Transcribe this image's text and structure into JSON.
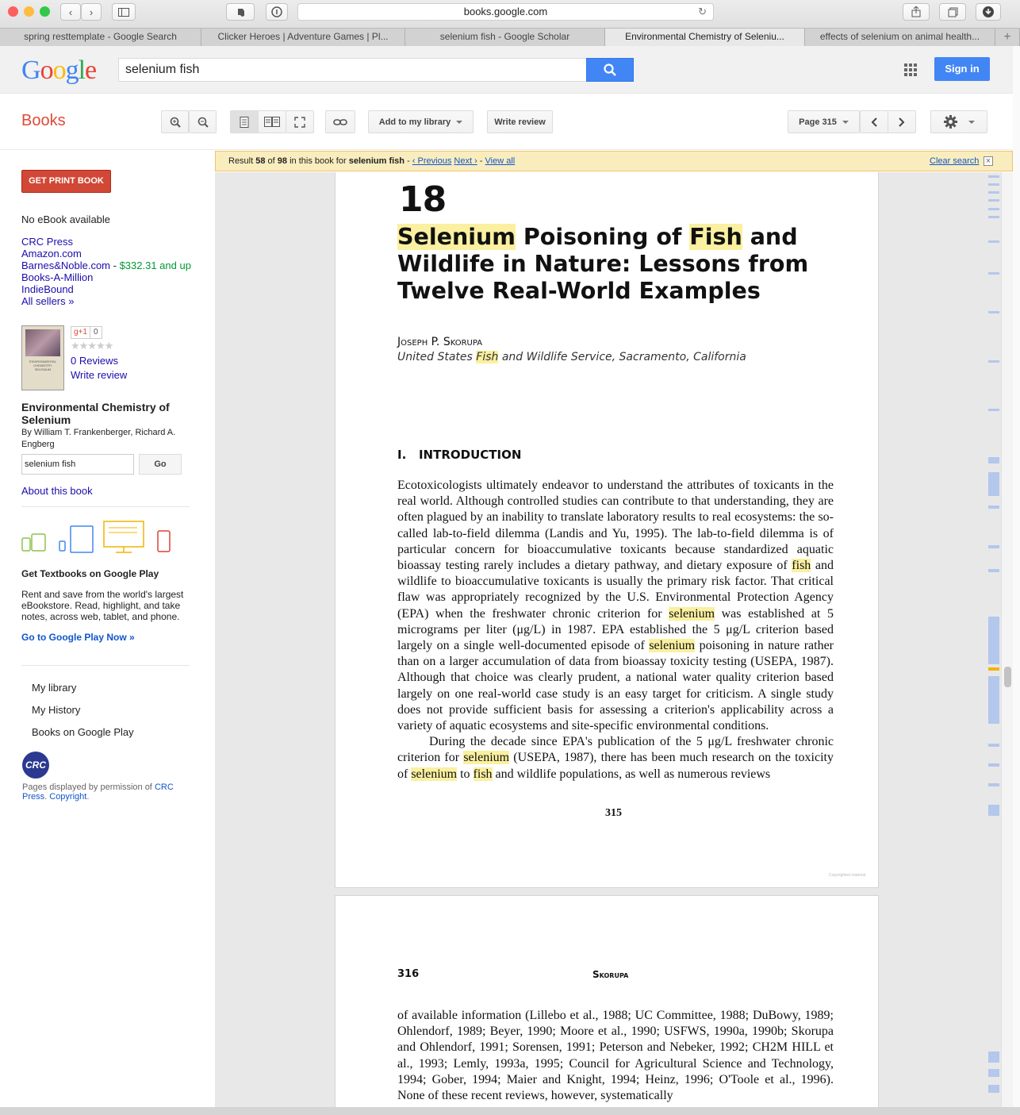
{
  "browser": {
    "url": "books.google.com",
    "tabs": [
      {
        "label": "spring resttemplate - Google Search",
        "active": false
      },
      {
        "label": "Clicker Heroes | Adventure Games | Pl...",
        "active": false
      },
      {
        "label": "selenium fish - Google Scholar",
        "active": false
      },
      {
        "label": "Environmental Chemistry of Seleniu...",
        "active": true
      },
      {
        "label": "effects of selenium on animal health...",
        "active": false
      }
    ],
    "new_tab": "+"
  },
  "header": {
    "logo": "Google",
    "search_value": "selenium fish",
    "signin_label": "Sign in"
  },
  "toolbar": {
    "title": "Books",
    "add_library_label": "Add to my library",
    "write_review_label": "Write review",
    "page_label": "Page 315"
  },
  "sidebar": {
    "print_button": "GET PRINT BOOK",
    "no_ebook": "No eBook available",
    "sellers": [
      {
        "name": "CRC Press"
      },
      {
        "name": "Amazon.com"
      },
      {
        "name": "Barnes&Noble.com",
        "price": "$332.31 and up"
      },
      {
        "name": "Books-A-Million"
      },
      {
        "name": "IndieBound"
      },
      {
        "name": "All sellers »"
      }
    ],
    "gplus_label": "g+1",
    "gplus_count": "0",
    "reviews": "0 Reviews",
    "write_review": "Write review",
    "book_title": "Environmental Chemistry of Selenium",
    "authors": "By William T. Frankenberger, Richard A. Engberg",
    "search_value": "selenium fish",
    "go_label": "Go",
    "about": "About this book",
    "promo_title": "Get Textbooks on Google Play",
    "promo_text": "Rent and save from the world's largest eBookstore. Read, highlight, and take notes, across web, tablet, and phone.",
    "promo_link": "Go to Google Play Now »",
    "nav": [
      "My library",
      "My History",
      "Books on Google Play"
    ],
    "crc_logo": "CRC",
    "permission_prefix": "Pages displayed by permission of ",
    "permission_link": "CRC Press",
    "copyright": "Copyright"
  },
  "result_bar": {
    "prefix": "Result ",
    "num": "58",
    "of": " of ",
    "total": "98",
    "mid": " in this book for ",
    "query": "selenium fish",
    "prev": "‹ Previous",
    "next": "Next ›",
    "view_all": "View all",
    "clear": "Clear search"
  },
  "page315": {
    "chapter": "18",
    "title_l1_hl1": "Selenium",
    "title_l1_a": " Poisoning of ",
    "title_l1_hl2": "Fish",
    "title_l1_b": " and",
    "title_l2": "Wildlife in Nature: Lessons from",
    "title_l3": "Twelve Real-World Examples",
    "author": "Joseph P. Skorupa",
    "affil_a": "United States ",
    "affil_hl": "Fish",
    "affil_b": " and Wildlife Service, Sacramento, California",
    "section": "I.   INTRODUCTION",
    "p1_a": "Ecotoxicologists ultimately endeavor to understand the attributes of toxicants in the real world. Although controlled studies can contribute to that understanding, they are often plagued by an inability to translate laboratory results to real ecosystems: the so-called lab-to-field dilemma (Landis and Yu, 1995). The lab-to-field dilemma is of particular concern for bioaccumulative toxicants because standardized aquatic bioassay testing rarely includes a dietary pathway, and dietary exposure of ",
    "p1_hl1": "fish",
    "p1_b": " and wildlife to bioaccumulative toxicants is usually the primary risk factor. That critical flaw was appropriately recognized by the U.S. Environmental Protection Agency (EPA) when the freshwater chronic criterion for ",
    "p1_hl2": "selenium",
    "p1_c": " was established at 5 micrograms per liter (μg/L) in 1987. EPA established the 5 μg/L criterion based largely on a single well-documented episode of ",
    "p1_hl3": "selenium",
    "p1_d": " poisoning in nature rather than on a larger accumulation of data from bioassay toxicity testing (USEPA, 1987). Although that choice was clearly prudent, a national water quality criterion based largely on one real-world case study is an easy target for criticism. A single study does not provide sufficient basis for assessing a criterion's applicability across a variety of aquatic ecosystems and site-specific environmental conditions.",
    "p2_a": "During the decade since EPA's publication of the 5 μg/L freshwater chronic criterion for ",
    "p2_hl1": "selenium",
    "p2_b": " (USEPA, 1987), there has been much research on the toxicity of ",
    "p2_hl2": "selenium",
    "p2_c": " to ",
    "p2_hl3": "fish",
    "p2_d": " and wildlife populations, as well as numerous reviews",
    "page_number": "315",
    "watermark": "Copyrighted material"
  },
  "page316": {
    "page_number": "316",
    "running_head": "Skorupa",
    "text": "of available information (Lillebo et al., 1988; UC Committee, 1988; DuBowy, 1989; Ohlendorf, 1989; Beyer, 1990; Moore et al., 1990; USFWS, 1990a, 1990b; Skorupa and Ohlendorf, 1991; Sorensen, 1991; Peterson and Nebeker, 1992; CH2M HILL et al., 1993; Lemly, 1993a, 1995; Council for Agricultural Science and Technology, 1994; Gober, 1994; Maier and Knight, 1994; Heinz, 1996; O'Toole et al., 1996). None of these recent reviews, however, systematically"
  },
  "colors": {
    "google_blue": "#4285f4",
    "books_red": "#dd4b39",
    "highlight": "#faf0a0",
    "result_bar": "#f9edbe"
  }
}
